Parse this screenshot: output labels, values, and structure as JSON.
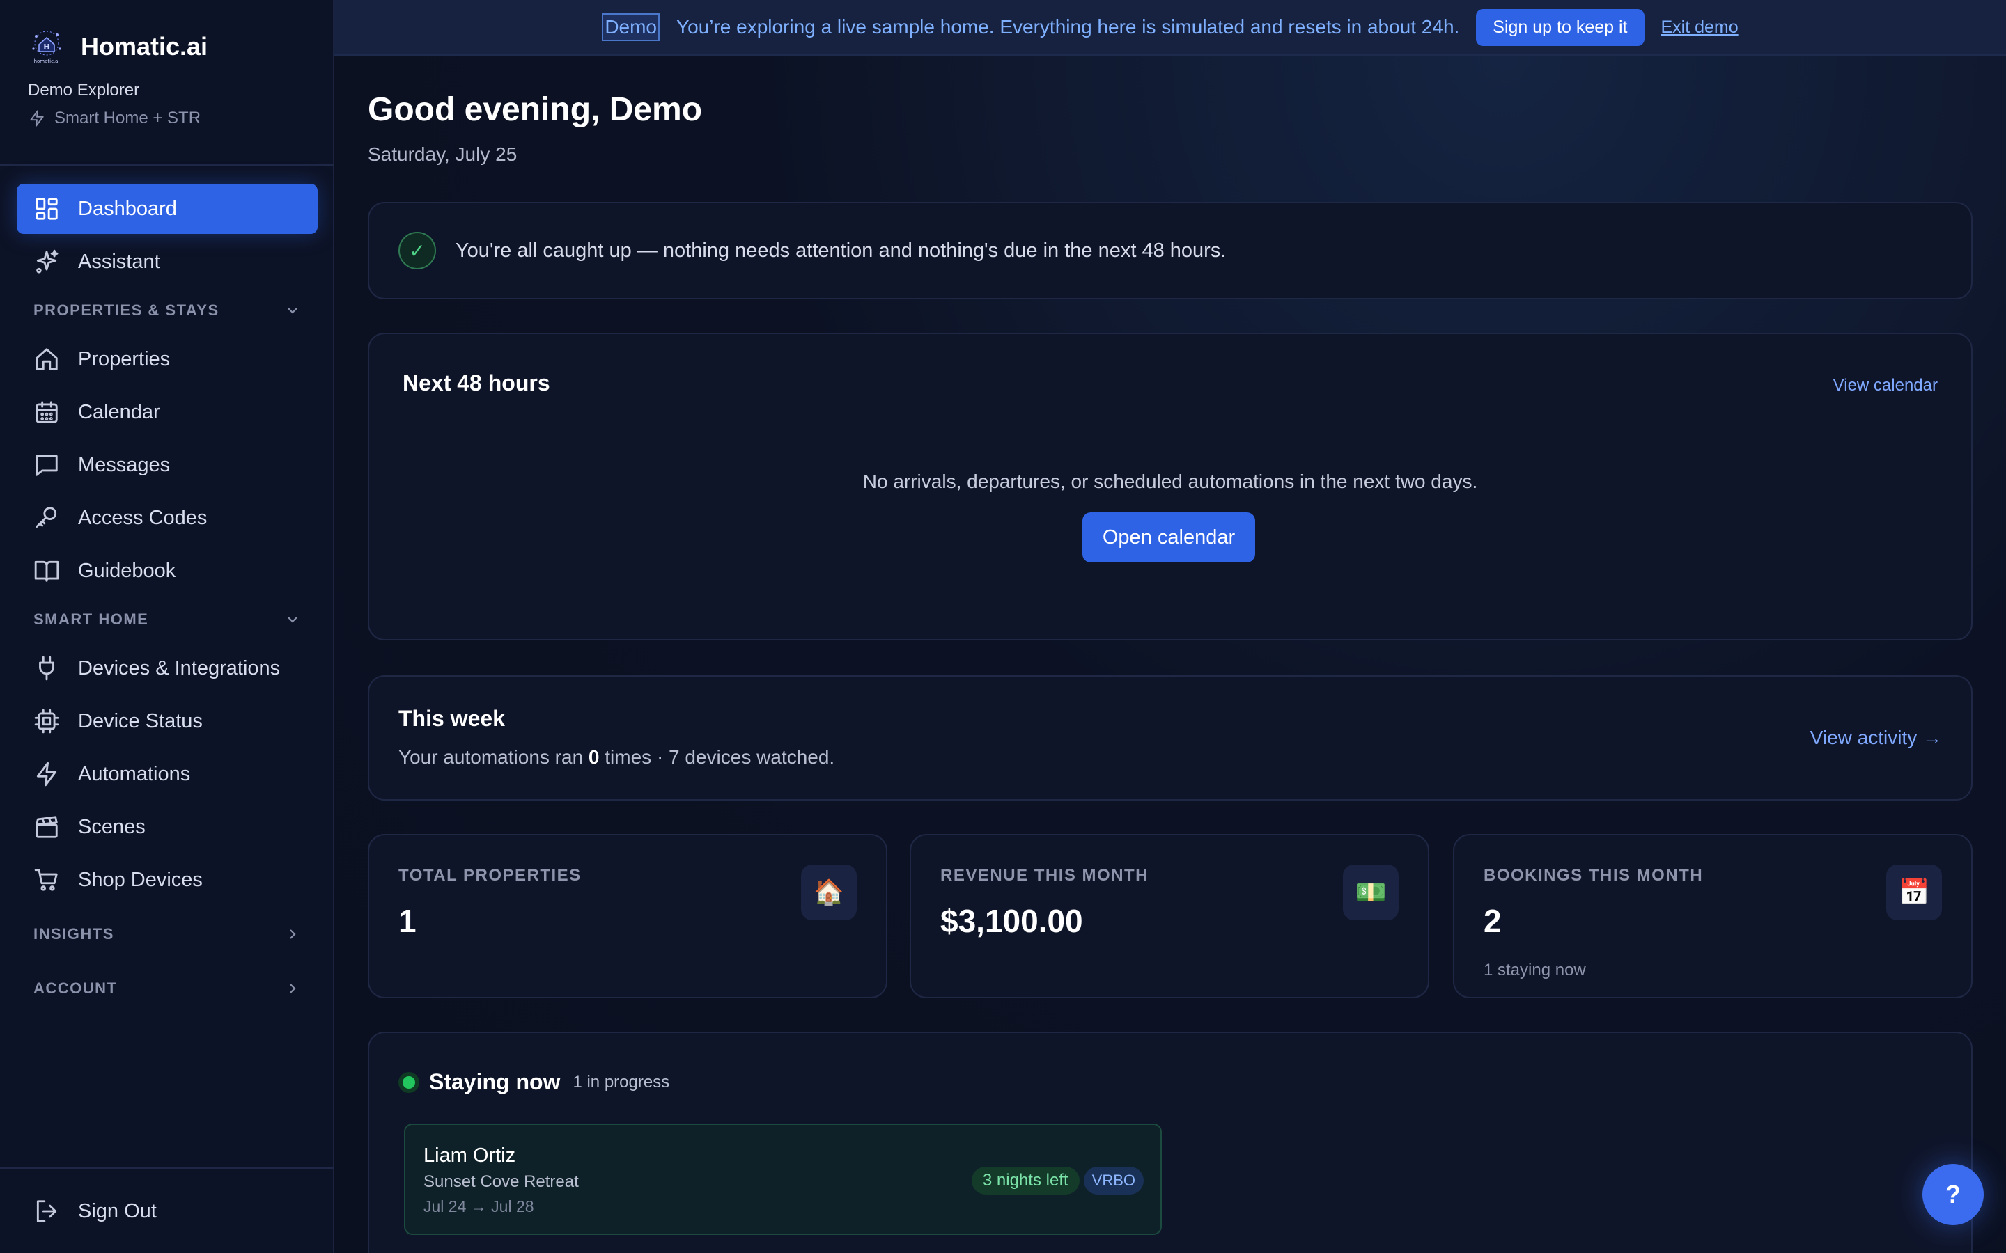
{
  "brand": {
    "name": "Homatic.ai",
    "logo_text": "homatic.ai",
    "user": "Demo Explorer",
    "plan": "Smart Home + STR"
  },
  "nav": {
    "dashboard": "Dashboard",
    "assistant": "Assistant",
    "section_properties": "PROPERTIES & STAYS",
    "properties": "Properties",
    "calendar": "Calendar",
    "messages": "Messages",
    "access_codes": "Access Codes",
    "guidebook": "Guidebook",
    "section_smart_home": "SMART HOME",
    "devices": "Devices & Integrations",
    "device_status": "Device Status",
    "automations": "Automations",
    "scenes": "Scenes",
    "shop": "Shop Devices",
    "section_insights": "INSIGHTS",
    "section_account": "ACCOUNT",
    "sign_out": "Sign Out"
  },
  "banner": {
    "chip": "Demo",
    "text": "You’re exploring a live sample home. Everything here is simulated and resets in about 24h.",
    "signup": "Sign up to keep it",
    "exit": "Exit demo"
  },
  "greeting": {
    "title": "Good evening, Demo",
    "date": "Saturday, July 25"
  },
  "caught_up": {
    "check": "✓",
    "text": "You're all caught up — nothing needs attention and nothing's due in the next 48 hours."
  },
  "next48": {
    "title": "Next 48 hours",
    "link": "View calendar",
    "empty": "No arrivals, departures, or scheduled automations in the next two days.",
    "button": "Open calendar"
  },
  "week": {
    "title": "This week",
    "prefix": "Your automations ran",
    "runs": "0",
    "suffix": "times · 7 devices watched.",
    "link": "View activity →"
  },
  "stats": [
    {
      "label": "TOTAL PROPERTIES",
      "value": "1",
      "sub": "",
      "icon": "🏠",
      "icon_name": "house-icon"
    },
    {
      "label": "REVENUE THIS MONTH",
      "value": "$3,100.00",
      "sub": "",
      "icon": "💵",
      "icon_name": "money-icon"
    },
    {
      "label": "BOOKINGS THIS MONTH",
      "value": "2",
      "sub": "1 staying now",
      "icon": "📅",
      "icon_name": "calendar-icon"
    }
  ],
  "staying": {
    "title": "Staying now",
    "count": "1 in progress",
    "guest": {
      "name": "Liam Ortiz",
      "property": "Sunset Cove Retreat",
      "dates": "Jul 24 → Jul 28",
      "nights": "3 nights left",
      "channel": "VRBO"
    }
  },
  "help": {
    "label": "?"
  },
  "colors": {
    "accent": "#2f63e6",
    "background": "#0b1020",
    "sidebar": "#0d1326",
    "success": "#22c55e",
    "link": "#7fa8ff"
  }
}
